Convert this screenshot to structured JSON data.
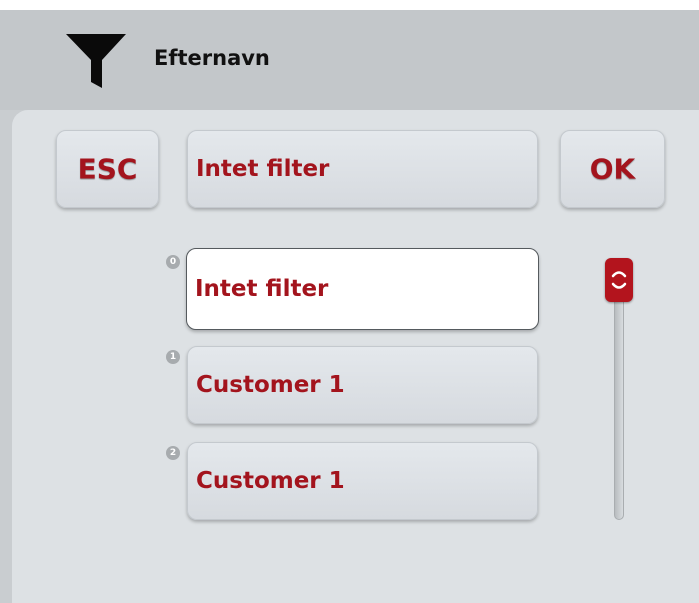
{
  "header": {
    "title": "Efternavn",
    "icon": "filter-funnel-icon"
  },
  "toolbar": {
    "esc_label": "ESC",
    "current_filter": "Intet filter",
    "ok_label": "OK"
  },
  "list": {
    "items": [
      {
        "index": "0",
        "label": "Intet filter",
        "selected": true
      },
      {
        "index": "1",
        "label": "Customer 1",
        "selected": false
      },
      {
        "index": "2",
        "label": "Customer 1",
        "selected": false
      }
    ]
  },
  "scrollbar": {
    "thumb_icon": "scroll-handle-icon"
  },
  "colors": {
    "accent_text": "#a3141d",
    "thumb": "#b3141d",
    "header_bg": "#c3c7ca",
    "panel_bg": "#dde1e4"
  }
}
